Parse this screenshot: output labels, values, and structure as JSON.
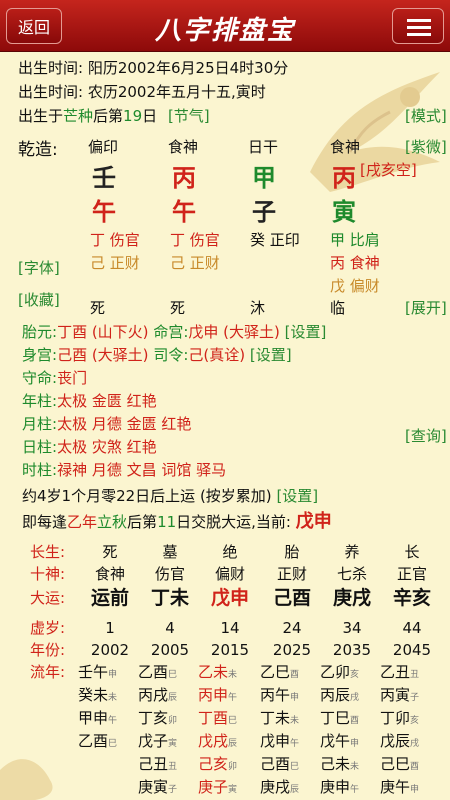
{
  "header": {
    "back": "返回",
    "title": "八字排盘宝",
    "menu_icon": "hamburger-menu-icon"
  },
  "birth": {
    "solar": "出生时间: 阳历2002年6月25日4时30分",
    "lunar": "出生时间: 农历2002年五月十五,寅时",
    "term_prefix": "出生于",
    "term": "芒种",
    "term_mid": "后第",
    "term_day": "19",
    "term_suffix": "日",
    "term_link": "[节气]",
    "mode_link": "[模式]"
  },
  "chart": {
    "label": "乾造:",
    "ziwei_link": "[紫微]",
    "kongwang": "[戌亥空]",
    "ten_gods": [
      "偏印",
      "食神",
      "日干",
      "食神"
    ],
    "stems": [
      "壬",
      "丙",
      "甲",
      "丙"
    ],
    "branches": [
      "午",
      "午",
      "子",
      "寅"
    ],
    "hidden": [
      [
        "丁 伤官",
        "己 正财"
      ],
      [
        "丁 伤官",
        "己 正财"
      ],
      [
        "癸 正印"
      ],
      [
        "甲 比肩",
        "丙 食神",
        "戊 偏财"
      ]
    ],
    "font_link": "[字体]",
    "collect_link": "[收藏]",
    "expand_link": "[展开]",
    "growth": [
      "死",
      "死",
      "沐",
      "临"
    ]
  },
  "info": [
    {
      "k": "胎元:",
      "v": "丁酉 (山下火)",
      "k2": "命宫:",
      "v2": "戊申 (大驿土)",
      "link": "[设置]"
    },
    {
      "k": "身宫:",
      "v": "己酉 (大驿土)",
      "k2": "司令:",
      "v2": "己(真诠)",
      "link": "[设置]"
    },
    {
      "k": "守命:",
      "v": "丧门"
    },
    {
      "k": "年柱:",
      "v": "太极 金匮 红艳"
    },
    {
      "k": "月柱:",
      "v": "太极 月德 金匮 红艳"
    },
    {
      "k": "日柱:",
      "v": "太极 灾煞 红艳",
      "link": "[查询]"
    },
    {
      "k": "时柱:",
      "v": "禄神 月德 文昌 词馆 驿马"
    }
  ],
  "luck": {
    "start": "约4岁1个月零22日后上运 (按岁累加)",
    "start_link": "[设置]",
    "each_a": "即每逢",
    "each_b": "乙年",
    "each_c": "立秋",
    "each_d": "后第",
    "each_e": "11",
    "each_f": "日交脱大运,当前: ",
    "current": "戊申"
  },
  "table": {
    "row_labels": [
      "长生:",
      "十神:",
      "大运:",
      "虚岁:",
      "年份:",
      "流年:"
    ],
    "growth": [
      "死",
      "墓",
      "绝",
      "胎",
      "养",
      "长"
    ],
    "gods": [
      "食神",
      "伤官",
      "偏财",
      "正财",
      "七杀",
      "正官"
    ],
    "dayun": [
      "运前",
      "丁未",
      "戊申",
      "己酉",
      "庚戌",
      "辛亥"
    ],
    "ages": [
      "1",
      "4",
      "14",
      "24",
      "34",
      "44"
    ],
    "years": [
      "2002",
      "2005",
      "2015",
      "2025",
      "2035",
      "2045"
    ],
    "liunian": [
      [
        [
          "壬午",
          "申"
        ],
        [
          "癸未",
          "未"
        ],
        [
          "甲申",
          "午"
        ],
        [
          "乙酉",
          "巳"
        ]
      ],
      [
        [
          "乙酉",
          "巳"
        ],
        [
          "丙戌",
          "辰"
        ],
        [
          "丁亥",
          "卯"
        ],
        [
          "戊子",
          "寅"
        ],
        [
          "己丑",
          "丑"
        ],
        [
          "庚寅",
          "子"
        ]
      ],
      [
        [
          "乙未",
          "未"
        ],
        [
          "丙申",
          "午"
        ],
        [
          "丁酉",
          "巳"
        ],
        [
          "戊戌",
          "辰"
        ],
        [
          "己亥",
          "卯"
        ],
        [
          "庚子",
          "寅"
        ]
      ],
      [
        [
          "乙巳",
          "酉"
        ],
        [
          "丙午",
          "申"
        ],
        [
          "丁未",
          "未"
        ],
        [
          "戊申",
          "午"
        ],
        [
          "己酉",
          "巳"
        ],
        [
          "庚戌",
          "辰"
        ]
      ],
      [
        [
          "乙卯",
          "亥"
        ],
        [
          "丙辰",
          "戌"
        ],
        [
          "丁巳",
          "酉"
        ],
        [
          "戊午",
          "申"
        ],
        [
          "己未",
          "未"
        ],
        [
          "庚申",
          "午"
        ]
      ],
      [
        [
          "乙丑",
          "丑"
        ],
        [
          "丙寅",
          "子"
        ],
        [
          "丁卯",
          "亥"
        ],
        [
          "戊辰",
          "戌"
        ],
        [
          "己巳",
          "酉"
        ],
        [
          "庚午",
          "申"
        ]
      ]
    ]
  },
  "colors": {
    "header": "#b51a14",
    "background": "#fbf5d0",
    "green": "#1e8a2c",
    "red": "#d0231a"
  }
}
